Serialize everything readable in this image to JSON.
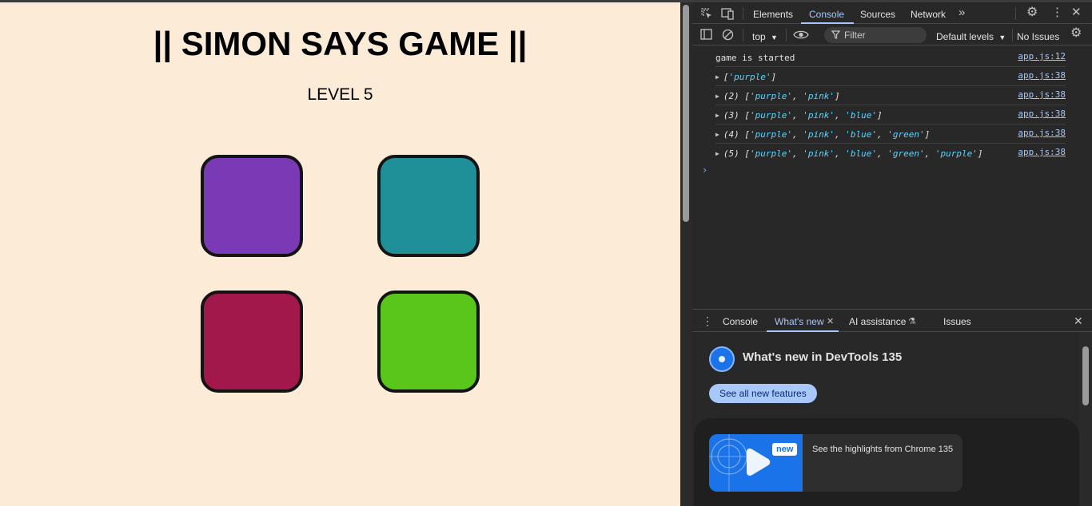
{
  "game": {
    "title": "|| SIMON SAYS GAME ||",
    "level": "LEVEL 5",
    "buttons": [
      {
        "id": "purple",
        "color": "#7b3ab5"
      },
      {
        "id": "teal",
        "color": "#1f8f98"
      },
      {
        "id": "pink",
        "color": "#a3184a"
      },
      {
        "id": "green",
        "color": "#58c71a"
      }
    ]
  },
  "devtools": {
    "tabs": [
      "Elements",
      "Console",
      "Sources",
      "Network"
    ],
    "active_tab": "Console",
    "context": "top",
    "filter_placeholder": "Filter",
    "levels": "Default levels",
    "issues": "No Issues",
    "logs": [
      {
        "message": "game is started",
        "source": "app.js:12"
      },
      {
        "count": "",
        "items": [
          "purple"
        ],
        "source": "app.js:38"
      },
      {
        "count": "(2)",
        "items": [
          "purple",
          "pink"
        ],
        "source": "app.js:38"
      },
      {
        "count": "(3)",
        "items": [
          "purple",
          "pink",
          "blue"
        ],
        "source": "app.js:38"
      },
      {
        "count": "(4)",
        "items": [
          "purple",
          "pink",
          "blue",
          "green"
        ],
        "source": "app.js:38"
      },
      {
        "count": "(5)",
        "items": [
          "purple",
          "pink",
          "blue",
          "green",
          "purple"
        ],
        "source": "app.js:38"
      }
    ],
    "drawer": {
      "tabs": [
        "Console",
        "What's new",
        "AI assistance",
        "Issues"
      ],
      "active_tab": "What's new",
      "heading": "What's new in DevTools 135",
      "see_all": "See all new features",
      "badge": "new",
      "highlight": "See the highlights from Chrome 135"
    }
  }
}
